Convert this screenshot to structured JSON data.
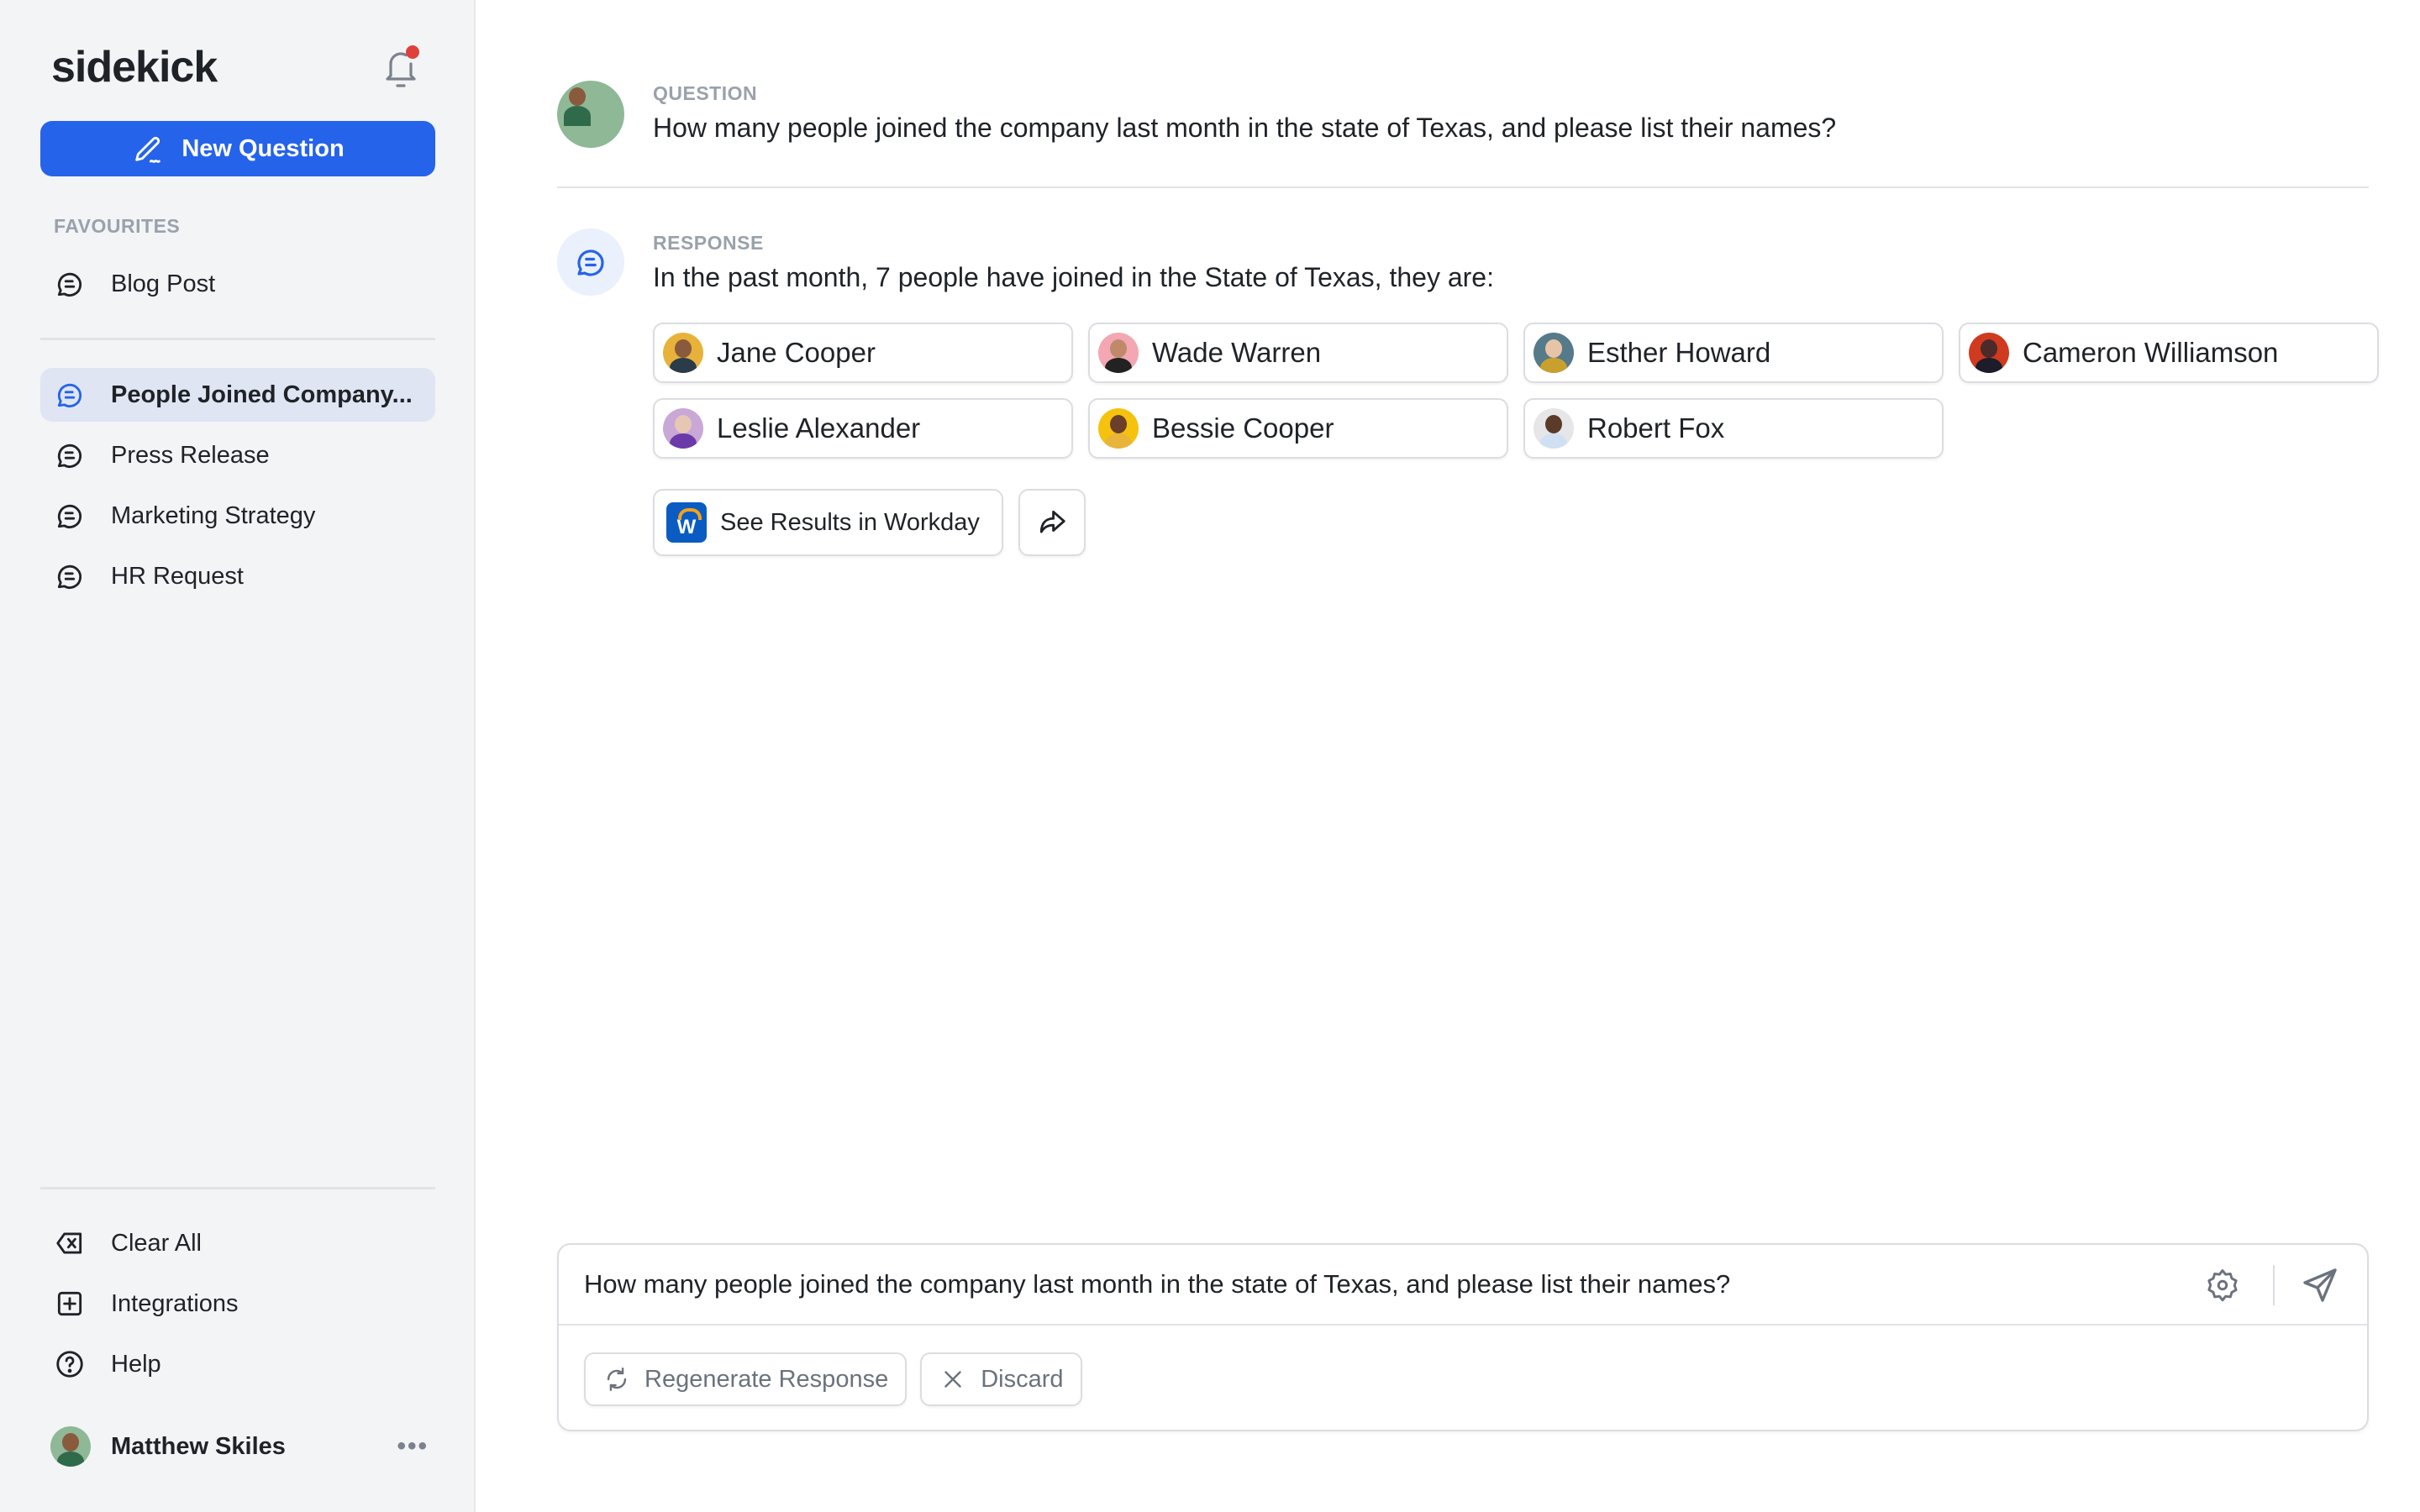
{
  "app": {
    "brand": "sidekick",
    "notification_badge": true
  },
  "sidebar": {
    "new_question_label": "New Question",
    "favourites_label": "FAVOURITES",
    "favourites": [
      {
        "label": "Blog Post",
        "icon": "chat-icon"
      }
    ],
    "history": [
      {
        "label": "People Joined Company...",
        "icon": "chat-icon",
        "active": true
      },
      {
        "label": "Press Release",
        "icon": "chat-icon"
      },
      {
        "label": "Marketing Strategy",
        "icon": "chat-icon"
      },
      {
        "label": "HR Request",
        "icon": "chat-icon"
      }
    ],
    "footer": [
      {
        "label": "Clear All",
        "icon": "backspace-x-icon"
      },
      {
        "label": "Integrations",
        "icon": "plus-square-icon"
      },
      {
        "label": "Help",
        "icon": "help-circle-icon"
      }
    ],
    "user": {
      "name": "Matthew Skiles",
      "more": "•••"
    }
  },
  "conversation": {
    "question_label": "QUESTION",
    "question_text": "How many people joined the company last month in the state of Texas, and please list their names?",
    "response_label": "RESPONSE",
    "response_text": "In the past month, 7 people have joined in the State of Texas, they are:",
    "people": [
      {
        "name": "Jane Cooper",
        "bg": "#e8b23a",
        "skin": "#8a5a3c",
        "shirt": "#2a3b4a"
      },
      {
        "name": "Wade Warren",
        "bg": "#f2a7b3",
        "skin": "#c08a6a",
        "shirt": "#222"
      },
      {
        "name": "Esther Howard",
        "bg": "#557a8a",
        "skin": "#e8c4a6",
        "shirt": "#c9a02e"
      },
      {
        "name": "Cameron Williamson",
        "bg": "#d03a1e",
        "skin": "#4b2a2a",
        "shirt": "#1c1c2a"
      },
      {
        "name": "Leslie Alexander",
        "bg": "#c9a7d6",
        "skin": "#e6c7b3",
        "shirt": "#6b3aa8"
      },
      {
        "name": "Bessie Cooper",
        "bg": "#f5c20e",
        "skin": "#6b3f2a",
        "shirt": "#e8b43a"
      },
      {
        "name": "Robert Fox",
        "bg": "#e6e6e8",
        "skin": "#5a3a28",
        "shirt": "#cfe0f2"
      }
    ],
    "workday_button_label": "See Results in Workday",
    "workday_logo_letter": "W"
  },
  "composer": {
    "value": "How many people joined the company last month in the state of Texas, and please list their names?",
    "regenerate_label": "Regenerate Response",
    "discard_label": "Discard"
  },
  "colors": {
    "accent": "#2563eb",
    "sidebar_bg": "#f3f4f6",
    "active_item_bg": "#dfe5f3",
    "badge": "#e0403a"
  }
}
